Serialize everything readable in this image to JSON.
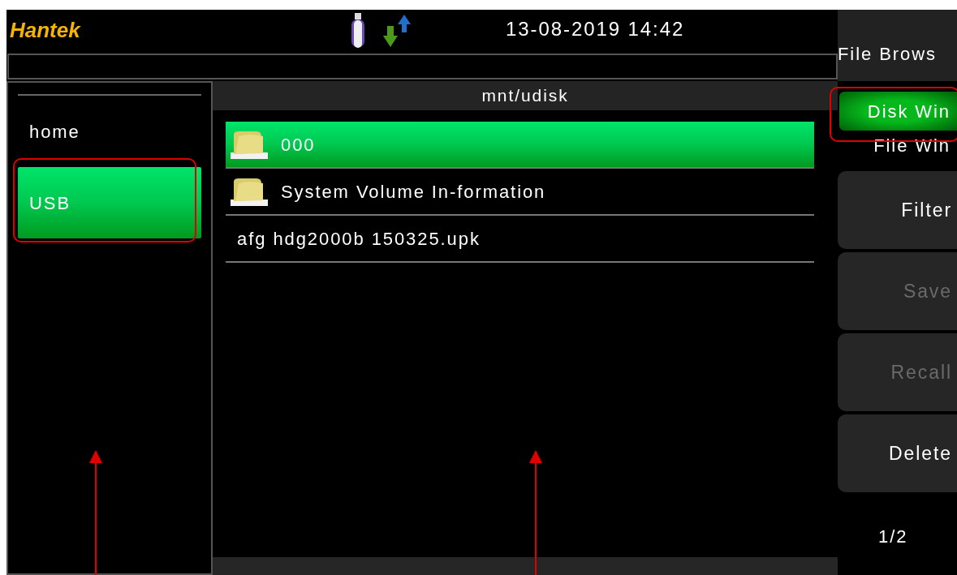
{
  "header": {
    "brand": "Hantek",
    "datetime": "13-08-2019 14:42"
  },
  "drives": [
    {
      "label": "home",
      "selected": false
    },
    {
      "label": "USB",
      "selected": true
    }
  ],
  "path": "mnt/udisk",
  "files": [
    {
      "name": "000",
      "kind": "folder",
      "selected": true
    },
    {
      "name": "System Volume In-formation",
      "kind": "folder",
      "selected": false
    },
    {
      "name": "afg hdg2000b 150325.upk",
      "kind": "file",
      "selected": false
    }
  ],
  "menu": {
    "title": "File Brows",
    "windows": [
      {
        "label": "Disk Win",
        "selected": true
      },
      {
        "label": "File Win",
        "selected": false
      }
    ],
    "buttons": [
      {
        "label": "Filter",
        "disabled": false
      },
      {
        "label": "Save",
        "disabled": true
      },
      {
        "label": "Recall",
        "disabled": true
      },
      {
        "label": "Delete",
        "disabled": false
      }
    ],
    "page": "1/2"
  }
}
